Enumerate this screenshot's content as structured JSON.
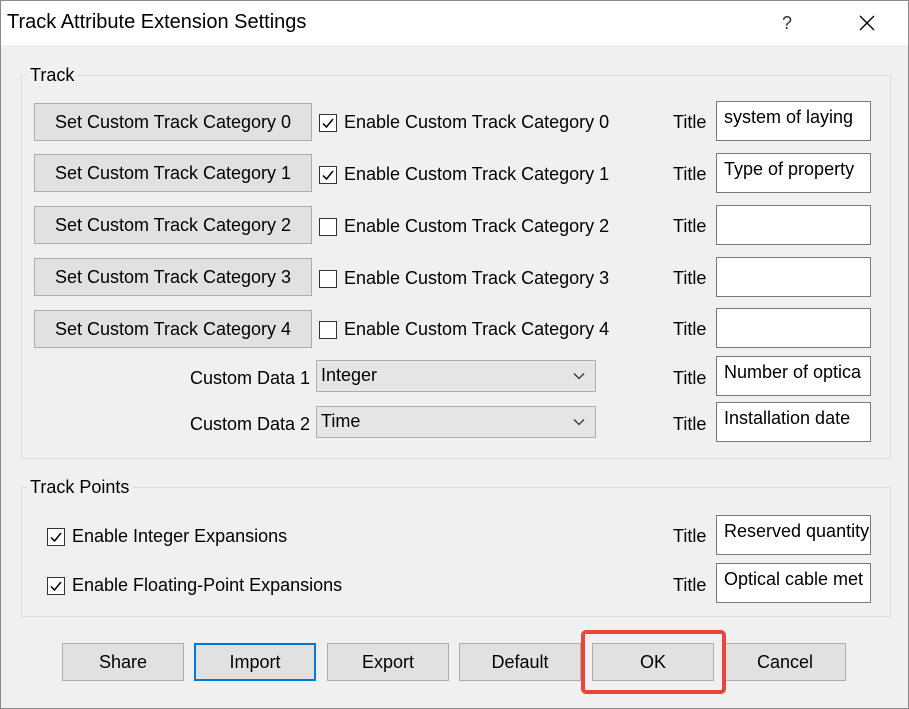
{
  "window": {
    "title": "Track Attribute Extension Settings",
    "help_label": "?",
    "close_icon": "close-icon"
  },
  "track_group": {
    "label": "Track",
    "categories": [
      {
        "button": "Set Custom Track Category 0",
        "enable": "Enable Custom Track Category 0",
        "checked": true,
        "title_label": "Title",
        "title_value": "system of laying"
      },
      {
        "button": "Set Custom Track Category 1",
        "enable": "Enable Custom Track Category 1",
        "checked": true,
        "title_label": "Title",
        "title_value": "Type of property"
      },
      {
        "button": "Set Custom Track Category 2",
        "enable": "Enable Custom Track Category 2",
        "checked": false,
        "title_label": "Title",
        "title_value": ""
      },
      {
        "button": "Set Custom Track Category 3",
        "enable": "Enable Custom Track Category 3",
        "checked": false,
        "title_label": "Title",
        "title_value": ""
      },
      {
        "button": "Set Custom Track Category 4",
        "enable": "Enable Custom Track Category 4",
        "checked": false,
        "title_label": "Title",
        "title_value": ""
      }
    ],
    "custom_data": [
      {
        "label": "Custom Data 1",
        "selected": "Integer",
        "title_label": "Title",
        "title_value": "Number of optica"
      },
      {
        "label": "Custom Data 2",
        "selected": "Time",
        "title_label": "Title",
        "title_value": "Installation date"
      }
    ]
  },
  "points_group": {
    "label": "Track Points",
    "options": [
      {
        "label": "Enable Integer Expansions",
        "checked": true,
        "title_label": "Title",
        "title_value": "Reserved quantity"
      },
      {
        "label": "Enable Floating-Point Expansions",
        "checked": true,
        "title_label": "Title",
        "title_value": "Optical cable met"
      }
    ]
  },
  "footer": {
    "share": "Share",
    "import": "Import",
    "export": "Export",
    "default": "Default",
    "ok": "OK",
    "cancel": "Cancel"
  },
  "colors": {
    "highlight": "#e8453c",
    "focus": "#0078d7"
  }
}
